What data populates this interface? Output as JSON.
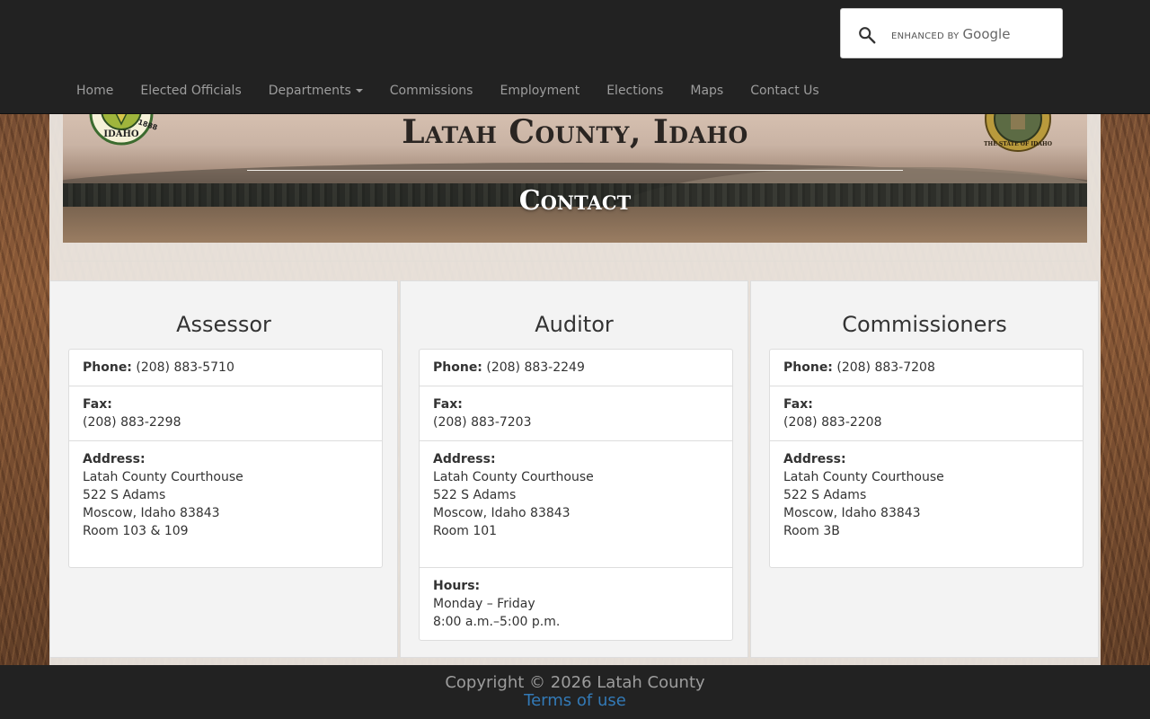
{
  "search": {
    "brand_prefix": "ENHANCED BY",
    "brand_name": "Google"
  },
  "nav": {
    "items": [
      {
        "label": "Home"
      },
      {
        "label": "Elected Officials"
      },
      {
        "label": "Departments"
      },
      {
        "label": "Commissions"
      },
      {
        "label": "Employment"
      },
      {
        "label": "Elections"
      },
      {
        "label": "Maps"
      },
      {
        "label": "Contact Us"
      }
    ]
  },
  "banner": {
    "title": "Latah County, Idaho",
    "subtitle": "Contact",
    "seal_left_year": "1888",
    "seal_left_text": "IDAHO",
    "seal_right_text": "THE STATE OF IDAHO"
  },
  "departments": [
    {
      "name": "Assessor",
      "phone_label": "Phone:",
      "phone": "(208) 883-5710",
      "fax_label": "Fax:",
      "fax": "(208) 883-2298",
      "address_label": "Address:",
      "address": [
        "Latah County Courthouse",
        "522 S Adams",
        "Moscow, Idaho 83843",
        "Room 103 & 109"
      ]
    },
    {
      "name": "Auditor",
      "phone_label": "Phone:",
      "phone": "(208) 883-2249",
      "fax_label": "Fax:",
      "fax": "(208) 883-7203",
      "address_label": "Address:",
      "address": [
        "Latah County Courthouse",
        "522 S Adams",
        "Moscow, Idaho 83843",
        "Room 101"
      ],
      "hours_label": "Hours:",
      "hours": [
        "Monday – Friday",
        "8:00 a.m.–5:00 p.m."
      ]
    },
    {
      "name": "Commissioners",
      "phone_label": "Phone:",
      "phone": "(208) 883-7208",
      "fax_label": "Fax:",
      "fax": "(208) 883-2208",
      "address_label": "Address:",
      "address": [
        "Latah County Courthouse",
        "522 S Adams",
        "Moscow, Idaho 83843",
        "Room 3B"
      ]
    }
  ],
  "footer": {
    "copyright": "Copyright © 2026 Latah County",
    "terms": "Terms of use"
  },
  "colors": {
    "navbar": "#222222",
    "link": "#337ab7",
    "nav_text": "#9d9d9d"
  }
}
